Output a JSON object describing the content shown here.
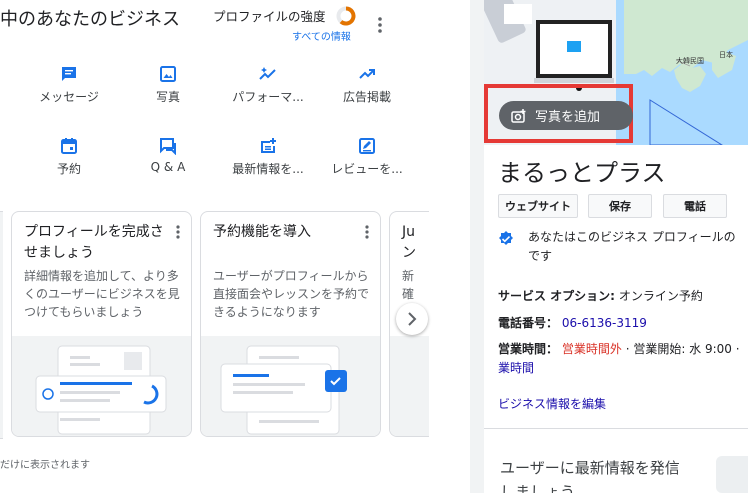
{
  "header": {
    "business_title": "中のあなたのビジネス",
    "profile_strength_label": "プロファイルの強度",
    "all_info_link": "すべての情報",
    "strength_ring_color": "#e37400"
  },
  "actions": [
    {
      "label": "メッセージ",
      "icon": "message-icon"
    },
    {
      "label": "写真",
      "icon": "photo-icon"
    },
    {
      "label": "パフォーマ...",
      "icon": "performance-icon"
    },
    {
      "label": "広告掲載",
      "icon": "ads-icon"
    },
    {
      "label": "予約",
      "icon": "calendar-icon"
    },
    {
      "label": "Q & A",
      "icon": "qa-icon"
    },
    {
      "label": "最新情報を...",
      "icon": "add-post-icon"
    },
    {
      "label": "レビューを...",
      "icon": "review-icon"
    }
  ],
  "cards": [
    {
      "title": "プロフィールを完成させましょう",
      "description": "詳細情報を追加して、より多くのユーザーにビジネスを見つけてもらいましょう"
    },
    {
      "title": "予約機能を導入",
      "description": "ユーザーがプロフィールから直接面会やレッスンを予約できるようになります"
    },
    {
      "title": "Ju ン",
      "description": "新 確"
    }
  ],
  "footnote": "だけに表示されます",
  "panel": {
    "add_photo_label": "写真を追加",
    "map_labels": {
      "japan": "日本",
      "korea": "大韓民国"
    },
    "business_name": "まるっとプラス",
    "buttons": {
      "website": "ウェブサイト",
      "save": "保存",
      "call": "電話"
    },
    "verified_line1": "あなたはこのビジネス プロフィールの",
    "verified_line2": "です",
    "service_label": "サービス オプション:",
    "service_value": "オンライン予約",
    "phone_label": "電話番号：",
    "phone_value": "06-6136-3119",
    "hours_label": "営業時間：",
    "hours_status": "営業時間外",
    "hours_next": "· 営業開始: 水 9:00 ·",
    "hours_more": "業時間",
    "edit_link": "ビジネス情報を編集",
    "post_prompt_line1": "ユーザーに最新情報を発信",
    "post_prompt_line2": "しましょう",
    "accent_color": "#1a73e8",
    "highlight_box_color": "#e53935"
  }
}
